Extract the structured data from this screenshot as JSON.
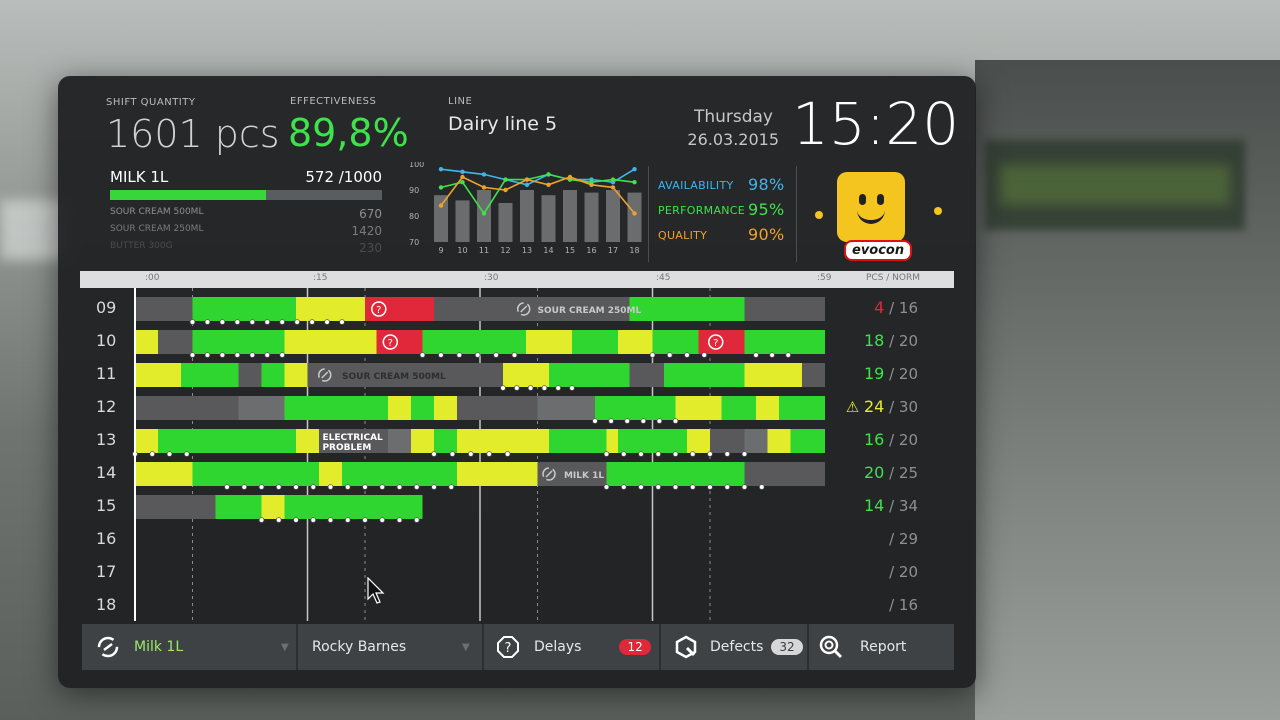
{
  "header": {
    "shift_label": "SHIFT QUANTITY",
    "shift_value": "1601 pcs",
    "eff_label": "EFFECTIVENESS",
    "eff_value": "89,8%",
    "line_label": "LINE",
    "line_value": "Dairy line 5",
    "day": "Thursday",
    "date": "26.03.2015",
    "time": "15:20"
  },
  "product": {
    "name": "MILK 1L",
    "count": "572 /1000",
    "progress": 0.572,
    "others": [
      {
        "name": "SOUR CREAM 500ML",
        "value": "670"
      },
      {
        "name": "SOUR CREAM 250ML",
        "value": "1420"
      },
      {
        "name": "BUTTER 300G",
        "value": "230"
      }
    ]
  },
  "spark": {
    "y_ticks": [
      "100",
      "90",
      "80",
      "70"
    ],
    "x_ticks": [
      "9",
      "10",
      "11",
      "12",
      "13",
      "14",
      "15",
      "16",
      "17",
      "18"
    ],
    "ylim": [
      70,
      100
    ],
    "bars": [
      88,
      86,
      90,
      85,
      90,
      88,
      90,
      89,
      90,
      89
    ],
    "lines": [
      {
        "name": "availability",
        "color": "#3fb6ea",
        "values": [
          98,
          97,
          96,
          94,
          92,
          96,
          94,
          94,
          93,
          98
        ]
      },
      {
        "name": "performance",
        "color": "#3ee24a",
        "values": [
          91,
          93,
          81,
          94,
          94,
          96,
          94,
          93,
          94,
          93
        ]
      },
      {
        "name": "quality",
        "color": "#f0a12d",
        "values": [
          84,
          95,
          91,
          90,
          94,
          92,
          95,
          92,
          91,
          81
        ]
      }
    ]
  },
  "metrics": [
    {
      "label": "AVAILABILITY",
      "value": "98%",
      "color": "#3fb6ea"
    },
    {
      "label": "PERFORMANCE",
      "value": "95%",
      "color": "#3ee24a"
    },
    {
      "label": "QUALITY",
      "value": "90%",
      "color": "#f0a12d"
    }
  ],
  "brand": "evocon",
  "timeline": {
    "ticks": [
      ":00",
      ":15",
      ":30",
      ":45",
      ":59"
    ],
    "pcs_header": "PCS / NORM",
    "colors": {
      "green": "#30d630",
      "yellow": "#e3ec2a",
      "red": "#e0283a",
      "gray": "#59595b",
      "lightgray": "#6c6d6f"
    },
    "rows": [
      {
        "hour": "09",
        "pcs": "4",
        "norm": "/ 16",
        "pcs_color": "#e0283a",
        "warn": false
      },
      {
        "hour": "10",
        "pcs": "18",
        "norm": "/ 20",
        "pcs_color": "#3ee24a",
        "warn": false
      },
      {
        "hour": "11",
        "pcs": "19",
        "norm": "/ 20",
        "pcs_color": "#3ee24a",
        "warn": false
      },
      {
        "hour": "12",
        "pcs": "24",
        "norm": "/ 30",
        "pcs_color": "#e3ec2a",
        "warn": true
      },
      {
        "hour": "13",
        "pcs": "16",
        "norm": "/ 20",
        "pcs_color": "#3ee24a",
        "warn": false
      },
      {
        "hour": "14",
        "pcs": "20",
        "norm": "/ 25",
        "pcs_color": "#3ee24a",
        "warn": false
      },
      {
        "hour": "15",
        "pcs": "14",
        "norm": "/ 34",
        "pcs_color": "#3ee24a",
        "warn": false
      },
      {
        "hour": "16",
        "pcs": "",
        "norm": "/ 29",
        "pcs_color": "#8e9193",
        "warn": false
      },
      {
        "hour": "17",
        "pcs": "",
        "norm": "/ 20",
        "pcs_color": "#8e9193",
        "warn": false
      },
      {
        "hour": "18",
        "pcs": "",
        "norm": "/ 16",
        "pcs_color": "#8e9193",
        "warn": false
      }
    ],
    "labels": {
      "sour_cream_250": "SOUR CREAM 250ML",
      "sour_cream_500": "SOUR CREAM 500ML",
      "electrical_1": "ELECTRICAL",
      "electrical_2": "PROBLEM",
      "milk": "MILK 1L"
    }
  },
  "bottom": {
    "product": "Milk 1L",
    "operator": "Rocky Barnes",
    "delays_label": "Delays",
    "delays_count": "12",
    "defects_label": "Defects",
    "defects_count": "32",
    "report_label": "Report"
  }
}
